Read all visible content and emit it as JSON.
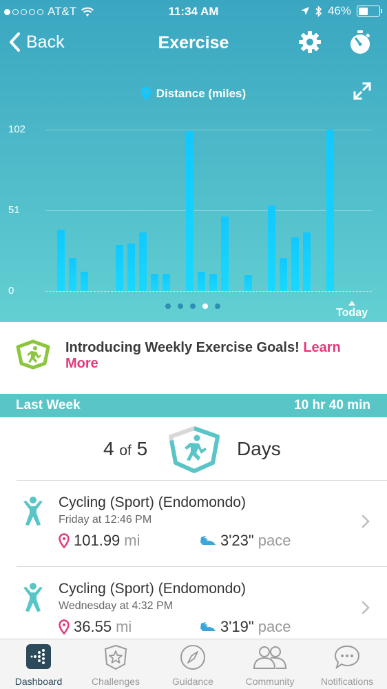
{
  "status_bar": {
    "carrier": "AT&T",
    "time": "11:34 AM",
    "battery": "46%",
    "battery_level": 0.46
  },
  "nav": {
    "back_label": "Back",
    "title": "Exercise"
  },
  "chart_header": {
    "metric_label": "Distance (miles)"
  },
  "chart_data": {
    "type": "bar",
    "y_ticks": [
      "102",
      "51",
      "0"
    ],
    "ylim": [
      0,
      102
    ],
    "values": [
      39,
      21,
      12,
      0,
      0,
      29,
      30,
      37,
      11,
      11,
      0,
      101,
      12,
      11,
      47,
      0,
      10,
      0,
      54,
      21,
      34,
      37,
      0,
      102
    ],
    "x_end_label": "Today",
    "grid": true
  },
  "pager": {
    "count": 5,
    "active_index": 3
  },
  "promo": {
    "text": "Introducing Weekly Exercise Goals! ",
    "link": "Learn More"
  },
  "section": {
    "label": "Last Week",
    "total": "10 hr 40 min"
  },
  "summary": {
    "done": "4",
    "of": "of",
    "goal": "5",
    "unit": "Days",
    "progress": 0.8
  },
  "exercises": [
    {
      "title": "Cycling (Sport) (Endomondo)",
      "when": "Friday at 12:46 PM",
      "distance": "101.99",
      "distance_unit": "mi",
      "pace": "3'23\"",
      "pace_unit": "pace"
    },
    {
      "title": "Cycling (Sport) (Endomondo)",
      "when": "Wednesday at 4:32 PM",
      "distance": "36.55",
      "distance_unit": "mi",
      "pace": "3'19\"",
      "pace_unit": "pace"
    }
  ],
  "tabs": [
    {
      "label": "Dashboard",
      "icon": "dashboard-icon",
      "active": true
    },
    {
      "label": "Challenges",
      "icon": "star-badge-icon",
      "active": false
    },
    {
      "label": "Guidance",
      "icon": "compass-icon",
      "active": false
    },
    {
      "label": "Community",
      "icon": "people-icon",
      "active": false
    },
    {
      "label": "Notifications",
      "icon": "chat-bubble-icon",
      "active": false
    }
  ],
  "colors": {
    "accent_teal": "#59c5c7",
    "link_pink": "#e3397b",
    "bar_blue": "#11c8ff",
    "badge_green": "#8cc63f"
  }
}
